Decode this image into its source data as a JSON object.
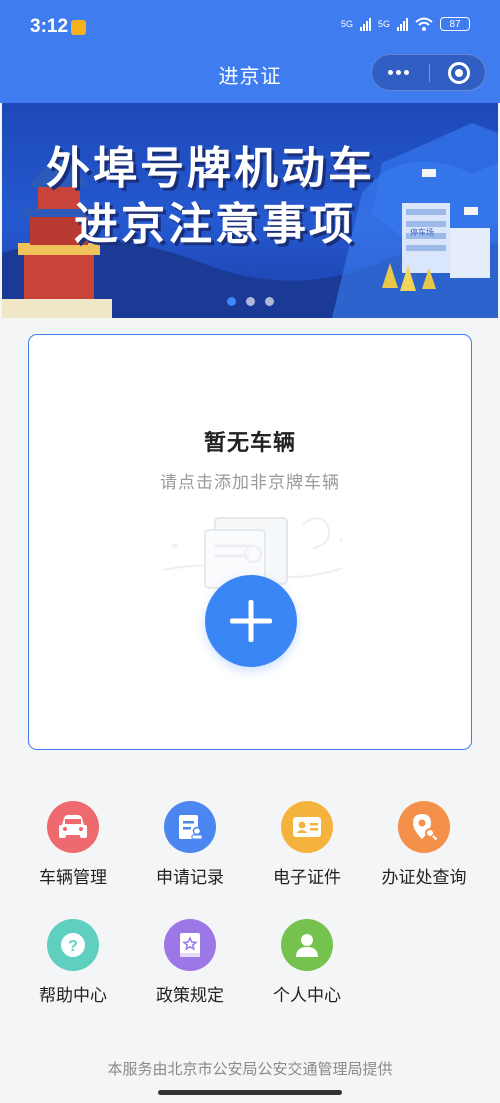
{
  "status_bar": {
    "time": "3:12",
    "net1": "5G",
    "net2": "5G",
    "battery": "87"
  },
  "nav": {
    "title": "进京证"
  },
  "banner": {
    "line1": "外埠号牌机动车",
    "line2": "进京注意事项",
    "sign": "停车场",
    "dots": 3,
    "active_dot": 0
  },
  "vehicle_card": {
    "title": "暂无车辆",
    "subtitle": "请点击添加非京牌车辆"
  },
  "menu": {
    "items": [
      {
        "label": "车辆管理",
        "icon": "car-icon",
        "color": "#ee6a6e"
      },
      {
        "label": "申请记录",
        "icon": "application-record-icon",
        "color": "#4b86f1"
      },
      {
        "label": "电子证件",
        "icon": "id-card-icon",
        "color": "#f4b33c"
      },
      {
        "label": "办证处查询",
        "icon": "location-search-icon",
        "color": "#f5904a"
      },
      {
        "label": "帮助中心",
        "icon": "help-icon",
        "color": "#5fcfc0"
      },
      {
        "label": "政策规定",
        "icon": "policy-book-icon",
        "color": "#9c77e6"
      },
      {
        "label": "个人中心",
        "icon": "user-icon",
        "color": "#76c24e"
      }
    ]
  },
  "footer": {
    "text": "本服务由北京市公安局公安交通管理局提供"
  }
}
